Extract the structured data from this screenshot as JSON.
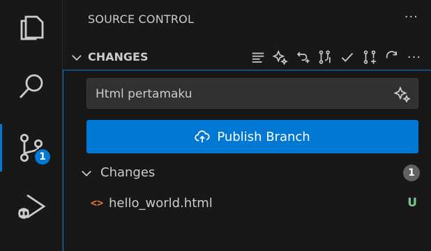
{
  "activity_bar": {
    "items": [
      {
        "icon": "explorer-icon"
      },
      {
        "icon": "search-icon"
      },
      {
        "icon": "source-control-icon",
        "badge": "1"
      },
      {
        "icon": "run-debug-icon"
      }
    ]
  },
  "sidebar": {
    "view_title": "SOURCE CONTROL",
    "more": "···",
    "section": {
      "title": "CHANGES",
      "toolbar": [
        "view-as-tree-icon",
        "sparkle-icon",
        "undo-icon",
        "branch-compare-icon",
        "commit-check-icon",
        "pull-request-icon",
        "refresh-icon",
        "more-icon"
      ],
      "more": "···"
    },
    "commit": {
      "value": "Html pertamaku",
      "placeholder": ""
    },
    "publish": {
      "label": "Publish Branch"
    },
    "changes_group": {
      "label": "Changes",
      "count": "1"
    },
    "files": [
      {
        "icon": "<>",
        "name": "hello_world.html",
        "status": "U"
      }
    ]
  },
  "colors": {
    "accent": "#0078d4",
    "untracked": "#73c991",
    "html_icon": "#e37933",
    "background": "#181818"
  }
}
